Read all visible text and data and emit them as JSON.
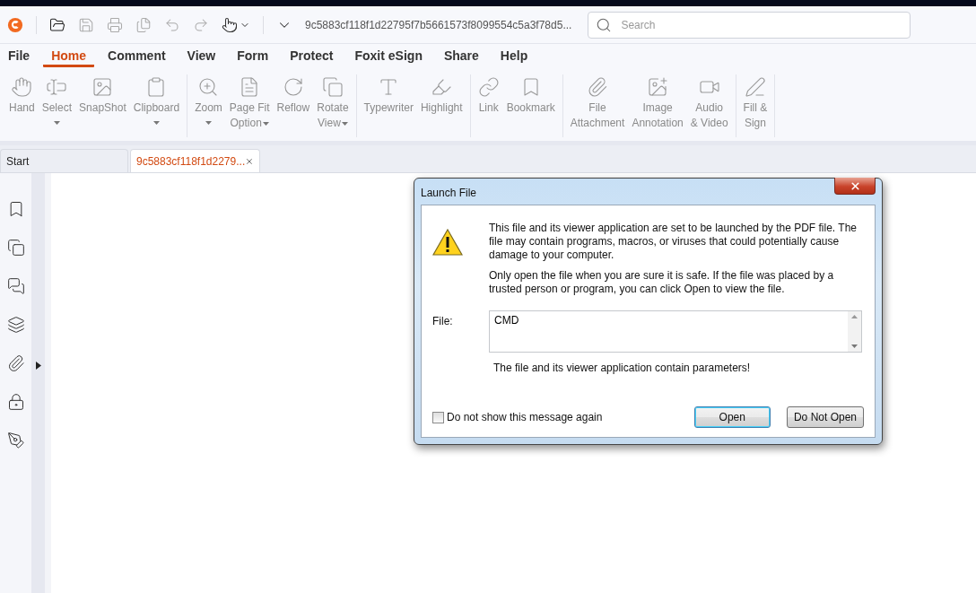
{
  "quick_bar": {
    "filename": "9c5883cf118f1d22795f7b5661573f8099554c5a3f78d5...",
    "search": {
      "placeholder": "Search"
    }
  },
  "menu": [
    {
      "label": "File",
      "selected": false
    },
    {
      "label": "Home",
      "selected": true
    },
    {
      "label": "Comment",
      "selected": false
    },
    {
      "label": "View",
      "selected": false
    },
    {
      "label": "Form",
      "selected": false
    },
    {
      "label": "Protect",
      "selected": false
    },
    {
      "label": "Foxit eSign",
      "selected": false
    },
    {
      "label": "Share",
      "selected": false
    },
    {
      "label": "Help",
      "selected": false
    }
  ],
  "ribbon": [
    [
      {
        "lines": [
          "Hand"
        ],
        "dropdown": false
      },
      {
        "lines": [
          "Select"
        ],
        "dropdown": true
      },
      {
        "lines": [
          "SnapShot"
        ],
        "dropdown": false
      },
      {
        "lines": [
          "Clipboard"
        ],
        "dropdown": true
      }
    ],
    [
      {
        "lines": [
          "Zoom"
        ],
        "dropdown": true
      },
      {
        "lines": [
          "Page Fit",
          "Option"
        ],
        "dropdown": true
      },
      {
        "lines": [
          "Reflow"
        ],
        "dropdown": false
      },
      {
        "lines": [
          "Rotate",
          "View"
        ],
        "dropdown": true
      }
    ],
    [
      {
        "lines": [
          "Typewriter"
        ],
        "dropdown": false
      },
      {
        "lines": [
          "Highlight"
        ],
        "dropdown": false
      }
    ],
    [
      {
        "lines": [
          "Link"
        ],
        "dropdown": false
      },
      {
        "lines": [
          "Bookmark"
        ],
        "dropdown": false
      }
    ],
    [
      {
        "lines": [
          "File",
          "Attachment"
        ],
        "dropdown": false
      },
      {
        "lines": [
          "Image",
          "Annotation"
        ],
        "dropdown": false
      },
      {
        "lines": [
          "Audio",
          "& Video"
        ],
        "dropdown": false
      }
    ],
    [
      {
        "lines": [
          "Fill &",
          "Sign"
        ],
        "dropdown": false
      }
    ]
  ],
  "doc_tabs": [
    {
      "label": "Start",
      "selected": false,
      "closable": false
    },
    {
      "label": "9c5883cf118f1d2279...",
      "selected": true,
      "closable": true
    }
  ],
  "dialog": {
    "title": "Launch File",
    "paragraphs": [
      "This file and its viewer application are set to be launched by the PDF file. The file may contain programs, macros, or viruses that could potentially cause damage to your computer.",
      "Only open the file when you are sure it is safe. If the file was placed by a trusted person or program, you can click Open to view the file."
    ],
    "file_label": "File:",
    "file_value": "CMD",
    "note": "The file and its viewer application contain parameters!",
    "checkbox": {
      "label": "Do not show this message again",
      "checked": false
    },
    "buttons": [
      {
        "label": "Open",
        "default": true
      },
      {
        "label": "Do Not Open",
        "default": false
      }
    ]
  }
}
